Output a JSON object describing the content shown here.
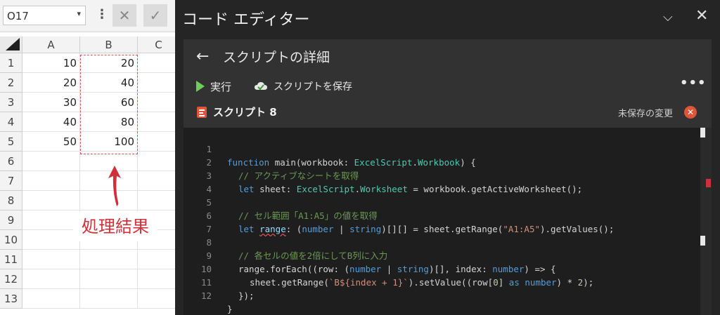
{
  "excel": {
    "name_box": "O17",
    "cancel_icon": "✕",
    "confirm_icon": "✓",
    "columns": [
      "A",
      "B",
      "C"
    ],
    "rows": [
      "1",
      "2",
      "3",
      "4",
      "5",
      "6",
      "7",
      "8",
      "9",
      "10",
      "11",
      "12",
      "13"
    ],
    "col_a": [
      "10",
      "20",
      "30",
      "40",
      "50"
    ],
    "col_b": [
      "20",
      "40",
      "60",
      "80",
      "100"
    ],
    "annotation": "処理結果"
  },
  "editor": {
    "title": "コード エディター",
    "detail_title": "スクリプトの詳細",
    "run_label": "実行",
    "save_label": "スクリプトを保存",
    "more_label": "•••",
    "script_name": "スクリプト 8",
    "unsaved_label": "未保存の変更",
    "line_numbers": [
      "1",
      "2",
      "3",
      "4",
      "5",
      "6",
      "7",
      "8",
      "9",
      "10",
      "11",
      "12"
    ],
    "code": {
      "l1": [
        "function",
        " main(workbook: ",
        "ExcelScript",
        ".",
        "Workbook",
        ") {"
      ],
      "l2": "// アクティブなシートを取得",
      "l3": [
        "let",
        " sheet: ",
        "ExcelScript",
        ".",
        "Worksheet",
        " = workbook.getActiveWorksheet();"
      ],
      "l5": "// セル範囲「A1:A5」の値を取得",
      "l6": [
        "let",
        " ",
        "range",
        ": (",
        "number",
        " | ",
        "string",
        ")[][] = sheet.getRange(",
        "\"A1:A5\"",
        ").getValues();"
      ],
      "l8": "// 各セルの値を2倍にしてB列に入力",
      "l9": [
        "range.forEach((row: (",
        "number",
        " | ",
        "string",
        ")[], index: ",
        "number",
        ") => {"
      ],
      "l10": [
        "sheet.getRange(",
        "`B${index + 1}`",
        ").setValue((row[",
        "0",
        "] ",
        "as",
        " ",
        "number",
        ") * ",
        "2",
        ");"
      ],
      "l11": "});",
      "l12": "}"
    }
  }
}
